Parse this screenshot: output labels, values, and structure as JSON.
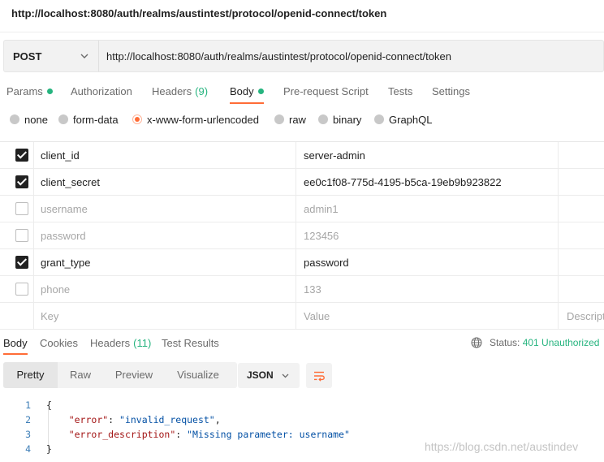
{
  "window_title": "http://localhost:8080/auth/realms/austintest/protocol/openid-connect/token",
  "request": {
    "method": "POST",
    "url": "http://localhost:8080/auth/realms/austintest/protocol/openid-connect/token"
  },
  "request_tabs": {
    "params": "Params",
    "authorization": "Authorization",
    "headers": "Headers",
    "headers_count": "(9)",
    "body": "Body",
    "pre_request": "Pre-request Script",
    "tests": "Tests",
    "settings": "Settings"
  },
  "body_types": {
    "none": "none",
    "form_data": "form-data",
    "urlencoded": "x-www-form-urlencoded",
    "raw": "raw",
    "binary": "binary",
    "graphql": "GraphQL",
    "selected": "x-www-form-urlencoded"
  },
  "params_table": {
    "rows": [
      {
        "checked": true,
        "key": "client_id",
        "value": "server-admin"
      },
      {
        "checked": true,
        "key": "client_secret",
        "value": "ee0c1f08-775d-4195-b5ca-19eb9b923822"
      },
      {
        "checked": false,
        "key": "username",
        "value": "admin1"
      },
      {
        "checked": false,
        "key": "password",
        "value": "123456"
      },
      {
        "checked": true,
        "key": "grant_type",
        "value": "password"
      },
      {
        "checked": false,
        "key": "phone",
        "value": "133"
      }
    ],
    "placeholder_key": "Key",
    "placeholder_value": "Value",
    "placeholder_description": "Descripti"
  },
  "response_tabs": {
    "body": "Body",
    "cookies": "Cookies",
    "headers": "Headers",
    "headers_count": "(11)",
    "test_results": "Test Results"
  },
  "status": {
    "label": "Status:",
    "code": "401 Unauthorized"
  },
  "view_modes": {
    "pretty": "Pretty",
    "raw": "Raw",
    "preview": "Preview",
    "visualize": "Visualize"
  },
  "format": "JSON",
  "response_body": {
    "line_numbers": [
      "1",
      "2",
      "3",
      "4"
    ],
    "open_brace": "{",
    "close_brace": "}",
    "error_key": "\"error\"",
    "error_value": "\"invalid_request\"",
    "error_description_key": "\"error_description\"",
    "error_description_value": "\"Missing parameter: username\""
  },
  "watermark": "https://blog.csdn.net/austindev",
  "colors": {
    "accent": "#ff6c37",
    "success": "#26b47f",
    "json_key": "#a31515",
    "json_string": "#0451a5"
  },
  "icons": [
    "chevron-down-icon",
    "globe-icon",
    "wrap-lines-icon",
    "checkbox-checked-icon",
    "checkbox-unchecked-icon"
  ]
}
